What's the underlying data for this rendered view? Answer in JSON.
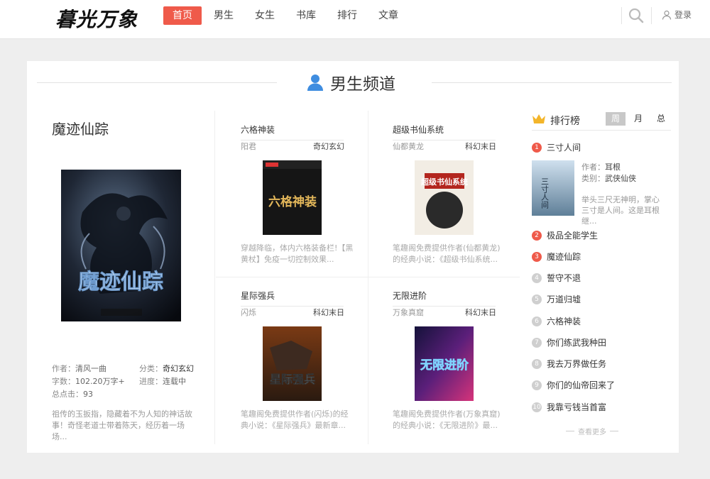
{
  "header": {
    "logo": "暮光万象",
    "nav": [
      "首页",
      "男生",
      "女生",
      "书库",
      "排行",
      "文章"
    ],
    "login": "登录"
  },
  "channel": {
    "title": "男生频道"
  },
  "featured": {
    "title": "魔迹仙踪",
    "cover_text": "魔迹仙踪",
    "author_label": "作者：",
    "author": "清风一曲",
    "category_label": "分类：",
    "category": "奇幻玄幻",
    "words_label": "字数：",
    "words": "102.20万字+",
    "progress_label": "进度：",
    "progress": "连载中",
    "clicks_label": "总点击：",
    "clicks": "93",
    "desc": "祖传的玉扳指，隐藏着不为人知的神话故事！奇怪老道士带着陈天，经历着一场场..."
  },
  "books": [
    {
      "title": "六格神装",
      "author": "阳君",
      "category": "奇幻玄幻",
      "cover_text": "六格神装",
      "desc": "穿越降临，体内六格装备栏!【黑黄杖】免疫一切控制效果..."
    },
    {
      "title": "超级书仙系统",
      "author": "仙都黄龙",
      "category": "科幻末日",
      "cover_text": "超级书仙系统",
      "desc": "笔趣阁免费提供作者(仙都黄龙)的经典小说：《超级书仙系统..."
    },
    {
      "title": "星际强兵",
      "author": "闪烁",
      "category": "科幻末日",
      "cover_text": "星际强兵",
      "desc": "笔趣阁免费提供作者(闪烁)的经典小说：《星际强兵》最新章..."
    },
    {
      "title": "无限进阶",
      "author": "万象真窟",
      "category": "科幻末日",
      "cover_text": "无限进阶",
      "desc": "笔趣阁免费提供作者(万象真窟)的经典小说：《无限进阶》最..."
    }
  ],
  "ranking": {
    "title": "排行榜",
    "tabs": [
      "周",
      "月",
      "总"
    ],
    "top": {
      "title": "三寸人间",
      "cover_text": "三寸人间",
      "author_label": "作者：",
      "author": "耳根",
      "category_label": "类别：",
      "category": "武侠仙侠",
      "desc": "举头三尺无神明，掌心三寸是人间。这是耳根继..."
    },
    "items": [
      {
        "num": "1",
        "title": "三寸人间"
      },
      {
        "num": "2",
        "title": "极品全能学生"
      },
      {
        "num": "3",
        "title": "魔迹仙踪"
      },
      {
        "num": "4",
        "title": "誓守不退"
      },
      {
        "num": "5",
        "title": "万道归墟"
      },
      {
        "num": "6",
        "title": "六格神装"
      },
      {
        "num": "7",
        "title": "你们练武我种田"
      },
      {
        "num": "8",
        "title": "我去万界做任务"
      },
      {
        "num": "9",
        "title": "你们的仙帝回来了"
      },
      {
        "num": "10",
        "title": "我靠亏钱当首富"
      }
    ],
    "more": "查看更多"
  },
  "colors": {
    "accent": "#ef5a4a",
    "channel_icon": "#3f8de0",
    "crown": "#f3b52a"
  }
}
